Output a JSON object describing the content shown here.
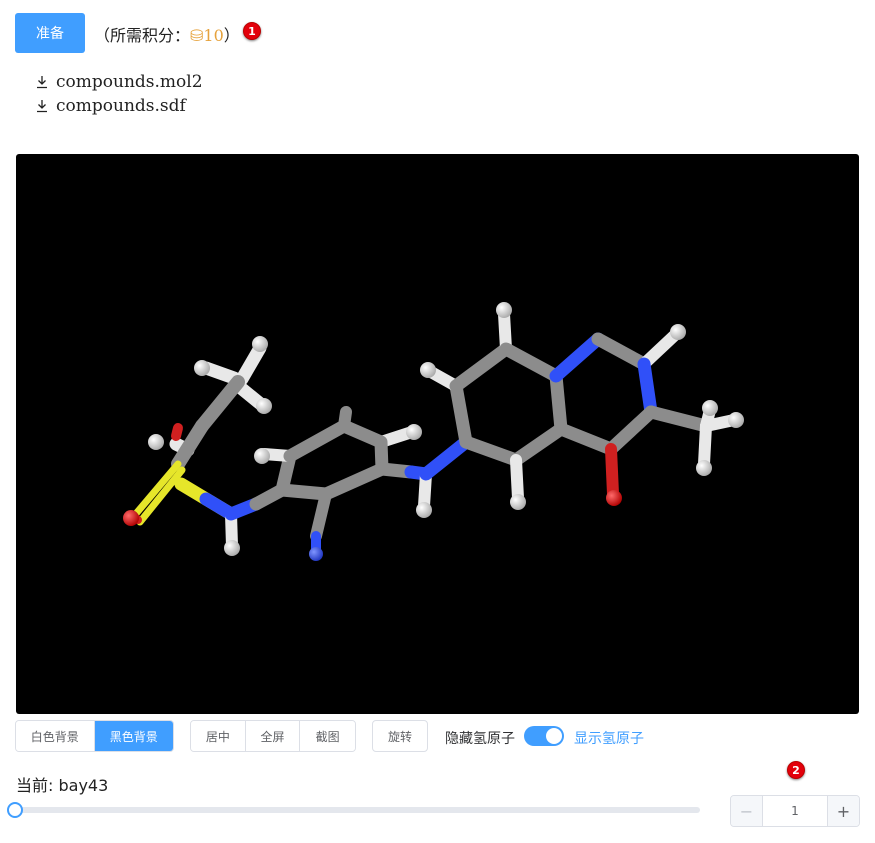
{
  "header": {
    "prepare_label": "准备",
    "cost_prefix": "（所需积分：",
    "cost_coin": "⛁10",
    "cost_suffix": "）",
    "badge_1": "1"
  },
  "downloads": [
    {
      "label": "compounds.mol2",
      "icon": "download-icon"
    },
    {
      "label": "compounds.sdf",
      "icon": "download-icon"
    }
  ],
  "viewer": {
    "background": "#000000",
    "molecule_colors": {
      "carbon": "#8c8c8c",
      "hydrogen": "#f0f0f0",
      "nitrogen": "#3050f8",
      "oxygen": "#ff0d0d",
      "sulfur": "#ffff30"
    }
  },
  "controls": {
    "bg_white": "白色背景",
    "bg_black": "黑色背景",
    "center": "居中",
    "fullscreen": "全屏",
    "screenshot": "截图",
    "rotate": "旋转",
    "hide_h": "隐藏氢原子",
    "show_h": "显示氢原子",
    "show_h_on": true
  },
  "current": {
    "text": "当前: bay43",
    "slider_fraction": 0,
    "badge_2": "2"
  },
  "stepper": {
    "minus": "−",
    "value": "1",
    "plus": "+"
  },
  "colors": {
    "accent": "#409eff",
    "coin": "#e6a23c",
    "badge": "#e3000b"
  }
}
